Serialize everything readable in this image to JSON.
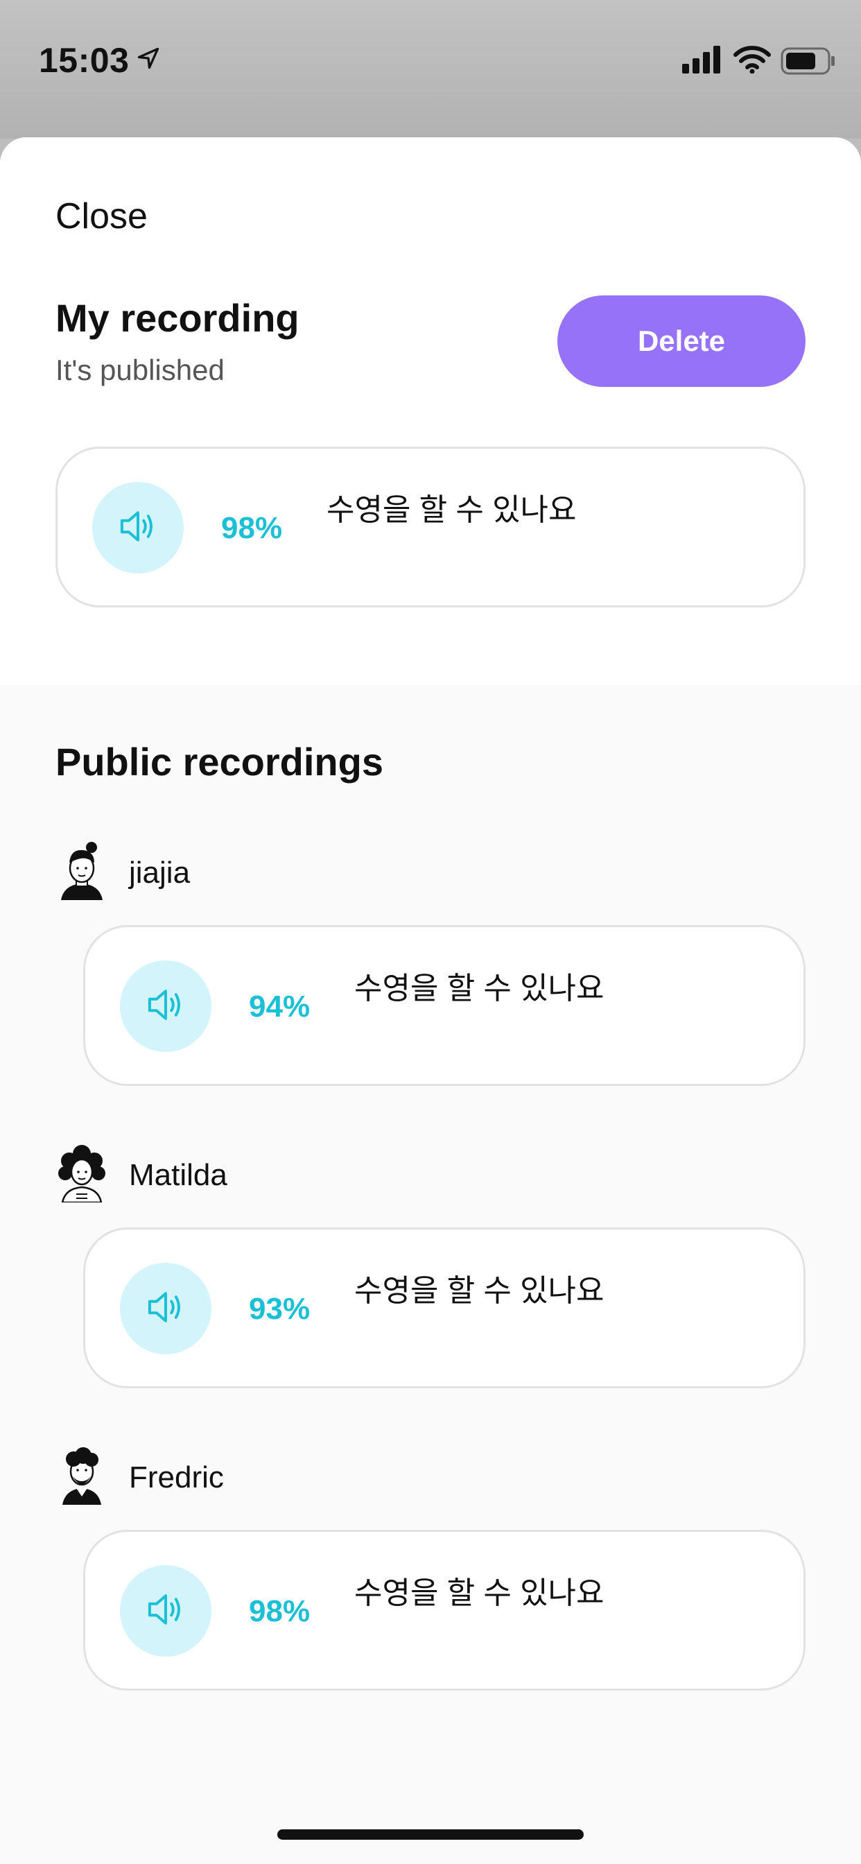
{
  "status": {
    "time": "15:03",
    "icons": [
      "location-arrow-icon",
      "cellular-signal-icon",
      "wifi-icon",
      "battery-icon"
    ]
  },
  "sheet": {
    "close_label": "Close",
    "my_recording": {
      "title": "My recording",
      "subtitle": "It's published",
      "delete_label": "Delete",
      "score": "98%",
      "phrase": "수영을 할 수 있나요"
    },
    "public": {
      "title": "Public recordings",
      "items": [
        {
          "user": "jiajia",
          "score": "94%",
          "phrase": "수영을 할 수 있나요"
        },
        {
          "user": "Matilda",
          "score": "93%",
          "phrase": "수영을 할 수 있나요"
        },
        {
          "user": "Fredric",
          "score": "98%",
          "phrase": "수영을 할 수 있나요"
        }
      ]
    }
  },
  "colors": {
    "accent_purple": "#9672f8",
    "score_cyan": "#1bbfd6",
    "play_bg": "#d2f4fa"
  }
}
